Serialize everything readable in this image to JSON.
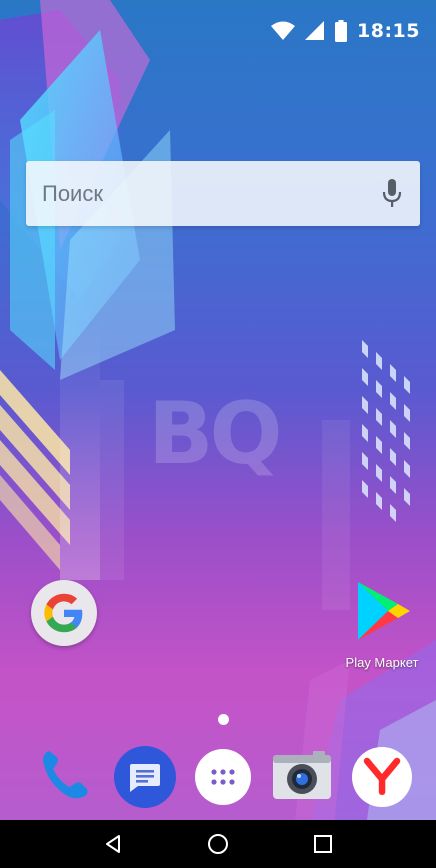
{
  "status_bar": {
    "time": "18:15",
    "icons": [
      "wifi-icon",
      "signal-icon",
      "battery-icon"
    ]
  },
  "search": {
    "placeholder": "Поиск",
    "icon": "mic-icon"
  },
  "wallpaper": {
    "brand_text": "BQ"
  },
  "desktop": {
    "apps": [
      {
        "name": "google-app",
        "icon": "google-g-icon",
        "label": ""
      },
      {
        "name": "play-market-app",
        "icon": "play-store-icon",
        "label": "Play Маркет"
      }
    ],
    "page_indicator": {
      "current": 1,
      "total": 1
    }
  },
  "dock": {
    "items": [
      {
        "icon": "phone-icon"
      },
      {
        "icon": "messages-icon"
      },
      {
        "icon": "app-drawer-icon"
      },
      {
        "icon": "camera-icon"
      },
      {
        "icon": "yandex-browser-icon"
      }
    ]
  },
  "nav_bar": {
    "buttons": [
      "back-icon",
      "home-icon",
      "recents-icon"
    ]
  },
  "colors": {
    "google_blue": "#4285F4",
    "google_red": "#EA4335",
    "google_yellow": "#FBBC05",
    "google_green": "#34A853",
    "phone_blue": "#1e88e5",
    "messages_blue": "#2962ff",
    "yandex_red": "#ff3333"
  }
}
